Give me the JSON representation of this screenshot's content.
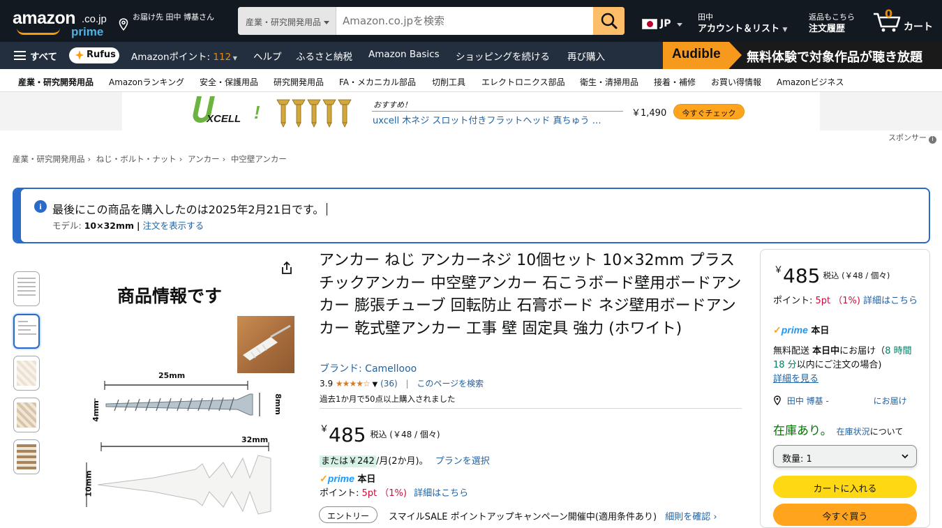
{
  "header": {
    "logo_text": "amazon",
    "logo_tld": ".co.jp",
    "logo_prime": "prime",
    "deliver_to": "お届け先 田中 博基さん",
    "search_category": "産業・研究開発用品",
    "search_placeholder": "Amazon.co.jpを検索",
    "lang": "JP",
    "account_line1": "田中",
    "account_line2": "アカウント＆リスト",
    "orders_line1": "返品もこちら",
    "orders_line2": "注文履歴",
    "cart_count": "0",
    "cart_label": "カート"
  },
  "mainnav": {
    "all": "すべて",
    "rufus": "Rufus",
    "points_label": "Amazonポイント:",
    "points_value": "112",
    "items": [
      "ヘルプ",
      "ふるさと納税",
      "Amazon Basics",
      "ショッピングを続ける",
      "再び購入"
    ],
    "audible_brand": "Audible",
    "audible_msg": "無料体験で対象作品が聴き放題"
  },
  "subnav": [
    "産業・研究開発用品",
    "Amazonランキング",
    "安全・保護用品",
    "研究開発用品",
    "FA・メカニカル部品",
    "切削工具",
    "エレクトロニクス部品",
    "衛生・清掃用品",
    "接着・補修",
    "お買い得情報",
    "Amazonビジネス"
  ],
  "ad": {
    "logo_word": "XCELL",
    "recommend": "おすすめ！",
    "title": "uxcell 木ネジ スロット付きフラットヘッド 真ちゅう …",
    "price": "￥1,490",
    "cta": "今すぐチェック",
    "sponsor": "スポンサー"
  },
  "breadcrumb": [
    "産業・研究開発用品",
    "ねじ・ボルト・ナット",
    "アンカー",
    "中空壁アンカー"
  ],
  "alert": {
    "message": "最後にこの商品を購入したのは2025年2月21日です。",
    "model_label": "モデル:",
    "model_value": "10×32mm",
    "link": "注文を表示する"
  },
  "image": {
    "title": "商品情報です",
    "dim_screw_length": "25mm",
    "dim_screw_head": "8mm",
    "dim_screw_dia": "4mm",
    "dim_anchor_length": "32mm",
    "dim_anchor_dia": "10mm"
  },
  "product": {
    "title": "アンカー ねじ アンカーネジ 10個セット 10×32mm プラスチックアンカー 中空壁アンカー 石こうボード壁用ボードアンカー 膨張チューブ 回転防止 石膏ボード ネジ壁用ボードアンカー 乾式壁アンカー 工事 壁 固定具 強力 (ホワイト)",
    "brand": "ブランド: Camellooo",
    "rating": "3.9",
    "stars_glyph": "★★★★☆",
    "review_count": "(36)",
    "search_page": "このページを検索",
    "bought": "過去1か月で50点以上購入されました",
    "price_symbol": "￥",
    "price": "485",
    "tax": "税込 (￥48 / 個々)",
    "installment_hl": "または￥242",
    "installment_rest": "/月(2か月)。",
    "plan_link": "プランを選択",
    "prime_day": "本日",
    "points_label": "ポイント:",
    "points_value": "5pt （1%)",
    "points_link": "詳細はこちら",
    "entry": "エントリー",
    "campaign": "スマイルSALE ポイントアップキャンペーン開催中(適用条件あり)",
    "campaign_link": "細則を確認"
  },
  "buybox": {
    "price_symbol": "￥",
    "price": "485",
    "tax": "税込 (￥48 / 個々)",
    "points_label": "ポイント:",
    "points_value": "5pt （1%)",
    "points_link": "詳細はこちら",
    "prime_day": "本日",
    "free_text": "無料配送",
    "free_bold": "本日中",
    "free_mid": "にお届け（",
    "free_time": "8 時間 18 分",
    "free_tail": "以内にご注文の場合)",
    "free_link": "詳細を見る",
    "location_name": "田中 博基 -",
    "location_tail": "にお届け",
    "stock": "在庫あり。",
    "stock_link": "在庫状況",
    "stock_tail": "について",
    "qty": "数量: 1",
    "add_cart": "カートに入れる",
    "buy_now": "今すぐ買う"
  }
}
